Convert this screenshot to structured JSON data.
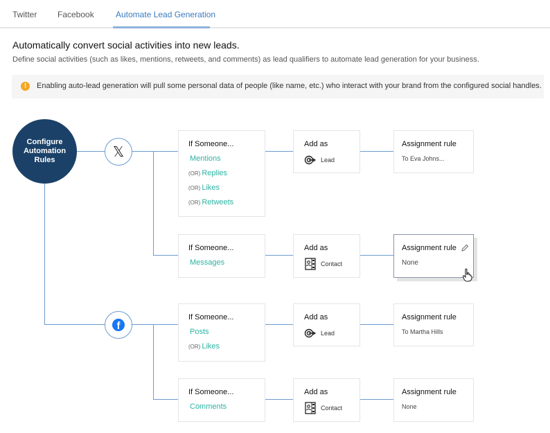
{
  "tabs": [
    {
      "label": "Twitter",
      "active": false
    },
    {
      "label": "Facebook",
      "active": false
    },
    {
      "label": "Automate Lead Generation",
      "active": true
    }
  ],
  "page": {
    "heading": "Automatically convert social activities into new leads.",
    "description": "Define social activities (such as likes, mentions, retweets, and comments) as lead qualifiers to automate lead generation for your business."
  },
  "notice": {
    "icon": "warning-icon",
    "text": "Enabling auto-lead generation will pull some personal data of people (like name, etc.) who interact with your brand from the configured social handles."
  },
  "hub": {
    "label": "Configure Automation Rules"
  },
  "colors": {
    "hub": "#1b4168",
    "connector": "#6b9bd0",
    "activity": "#2bb3a3",
    "active_tab": "#3a7bbf",
    "warning": "#f5a623",
    "facebook": "#1877f2"
  },
  "networks": [
    {
      "name": "Twitter (X)",
      "icon": "x-logo-icon",
      "glyph": "𝕏",
      "rules": [
        {
          "condition_title": "If Someone...",
          "activities": [
            {
              "prefix": "",
              "label": "Mentions"
            },
            {
              "prefix": "(OR)",
              "label": "Replies"
            },
            {
              "prefix": "(OR)",
              "label": "Likes"
            },
            {
              "prefix": "(OR)",
              "label": "Retweets"
            }
          ],
          "add_title": "Add as",
          "add_type": "Lead",
          "add_icon": "target-icon",
          "assign_title": "Assignment rule",
          "assign_value": "To Eva Johns..."
        },
        {
          "condition_title": "If Someone...",
          "activities": [
            {
              "prefix": "",
              "label": "Messages"
            }
          ],
          "add_title": "Add as",
          "add_type": "Contact",
          "add_icon": "contact-book-icon",
          "assign_title": "Assignment rule",
          "assign_value": "None"
        }
      ]
    },
    {
      "name": "Facebook",
      "icon": "facebook-logo-icon",
      "glyph": "f",
      "rules": [
        {
          "condition_title": "If Someone...",
          "activities": [
            {
              "prefix": "",
              "label": "Posts"
            },
            {
              "prefix": "(OR)",
              "label": "Likes"
            }
          ],
          "add_title": "Add as",
          "add_type": "Lead",
          "add_icon": "target-icon",
          "assign_title": "Assignment rule",
          "assign_value": "To Martha Hills"
        },
        {
          "condition_title": "If Someone...",
          "activities": [
            {
              "prefix": "",
              "label": "Comments"
            }
          ],
          "add_title": "Add as",
          "add_type": "Contact",
          "add_icon": "contact-book-icon",
          "assign_title": "Assignment rule",
          "assign_value": "None"
        }
      ]
    }
  ]
}
